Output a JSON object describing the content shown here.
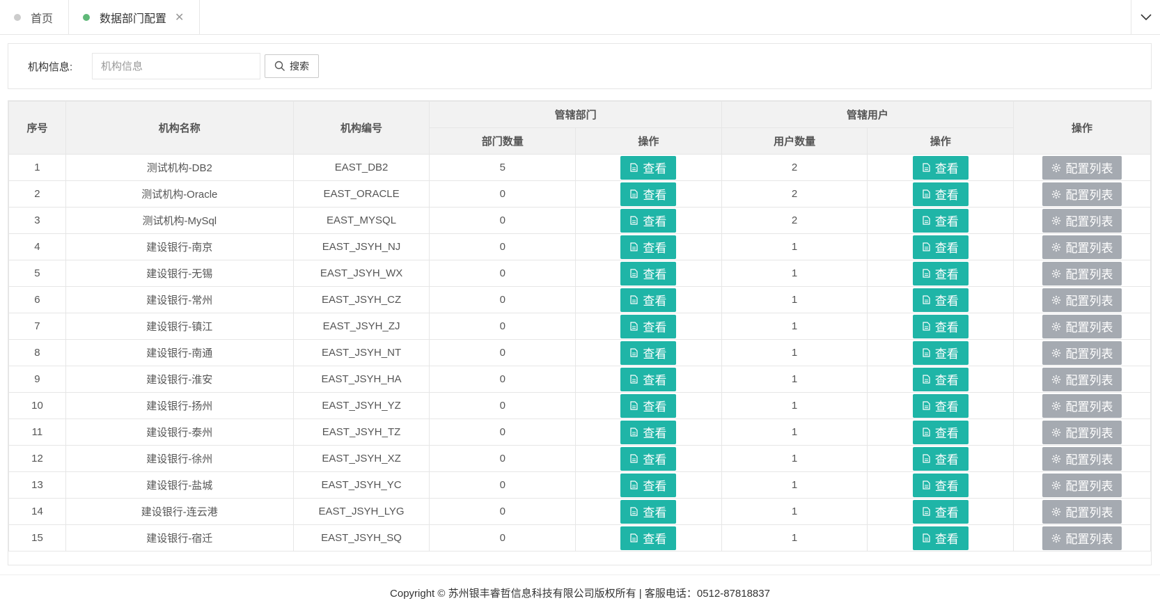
{
  "tabs": [
    {
      "label": "首页",
      "active": false
    },
    {
      "label": "数据部门配置",
      "active": true
    }
  ],
  "search": {
    "label": "机构信息:",
    "placeholder": "机构信息",
    "value": "",
    "button_label": "搜索"
  },
  "table": {
    "headers": {
      "index": "序号",
      "org_name": "机构名称",
      "org_code": "机构编号",
      "dept_group": "管辖部门",
      "dept_count": "部门数量",
      "dept_action": "操作",
      "user_group": "管辖用户",
      "user_count": "用户数量",
      "user_action": "操作",
      "action": "操作"
    },
    "view_label": "查看",
    "config_label": "配置列表",
    "rows": [
      {
        "index": "1",
        "name": "测试机构-DB2",
        "code": "EAST_DB2",
        "dept_count": "5",
        "user_count": "2"
      },
      {
        "index": "2",
        "name": "测试机构-Oracle",
        "code": "EAST_ORACLE",
        "dept_count": "0",
        "user_count": "2"
      },
      {
        "index": "3",
        "name": "测试机构-MySql",
        "code": "EAST_MYSQL",
        "dept_count": "0",
        "user_count": "2"
      },
      {
        "index": "4",
        "name": "建设银行-南京",
        "code": "EAST_JSYH_NJ",
        "dept_count": "0",
        "user_count": "1"
      },
      {
        "index": "5",
        "name": "建设银行-无锡",
        "code": "EAST_JSYH_WX",
        "dept_count": "0",
        "user_count": "1"
      },
      {
        "index": "6",
        "name": "建设银行-常州",
        "code": "EAST_JSYH_CZ",
        "dept_count": "0",
        "user_count": "1"
      },
      {
        "index": "7",
        "name": "建设银行-镇江",
        "code": "EAST_JSYH_ZJ",
        "dept_count": "0",
        "user_count": "1"
      },
      {
        "index": "8",
        "name": "建设银行-南通",
        "code": "EAST_JSYH_NT",
        "dept_count": "0",
        "user_count": "1"
      },
      {
        "index": "9",
        "name": "建设银行-淮安",
        "code": "EAST_JSYH_HA",
        "dept_count": "0",
        "user_count": "1"
      },
      {
        "index": "10",
        "name": "建设银行-扬州",
        "code": "EAST_JSYH_YZ",
        "dept_count": "0",
        "user_count": "1"
      },
      {
        "index": "11",
        "name": "建设银行-泰州",
        "code": "EAST_JSYH_TZ",
        "dept_count": "0",
        "user_count": "1"
      },
      {
        "index": "12",
        "name": "建设银行-徐州",
        "code": "EAST_JSYH_XZ",
        "dept_count": "0",
        "user_count": "1"
      },
      {
        "index": "13",
        "name": "建设银行-盐城",
        "code": "EAST_JSYH_YC",
        "dept_count": "0",
        "user_count": "1"
      },
      {
        "index": "14",
        "name": "建设银行-连云港",
        "code": "EAST_JSYH_LYG",
        "dept_count": "0",
        "user_count": "1"
      },
      {
        "index": "15",
        "name": "建设银行-宿迁",
        "code": "EAST_JSYH_SQ",
        "dept_count": "0",
        "user_count": "1"
      }
    ]
  },
  "footer": {
    "text": "Copyright © 苏州银丰睿哲信息科技有限公司版权所有 | 客服电话：0512-87818837"
  },
  "colors": {
    "view_button": "#1fb5a7",
    "config_button": "#a5aab1",
    "active_tab_dot": "#5fb878",
    "inactive_tab_dot": "#cccccc"
  }
}
